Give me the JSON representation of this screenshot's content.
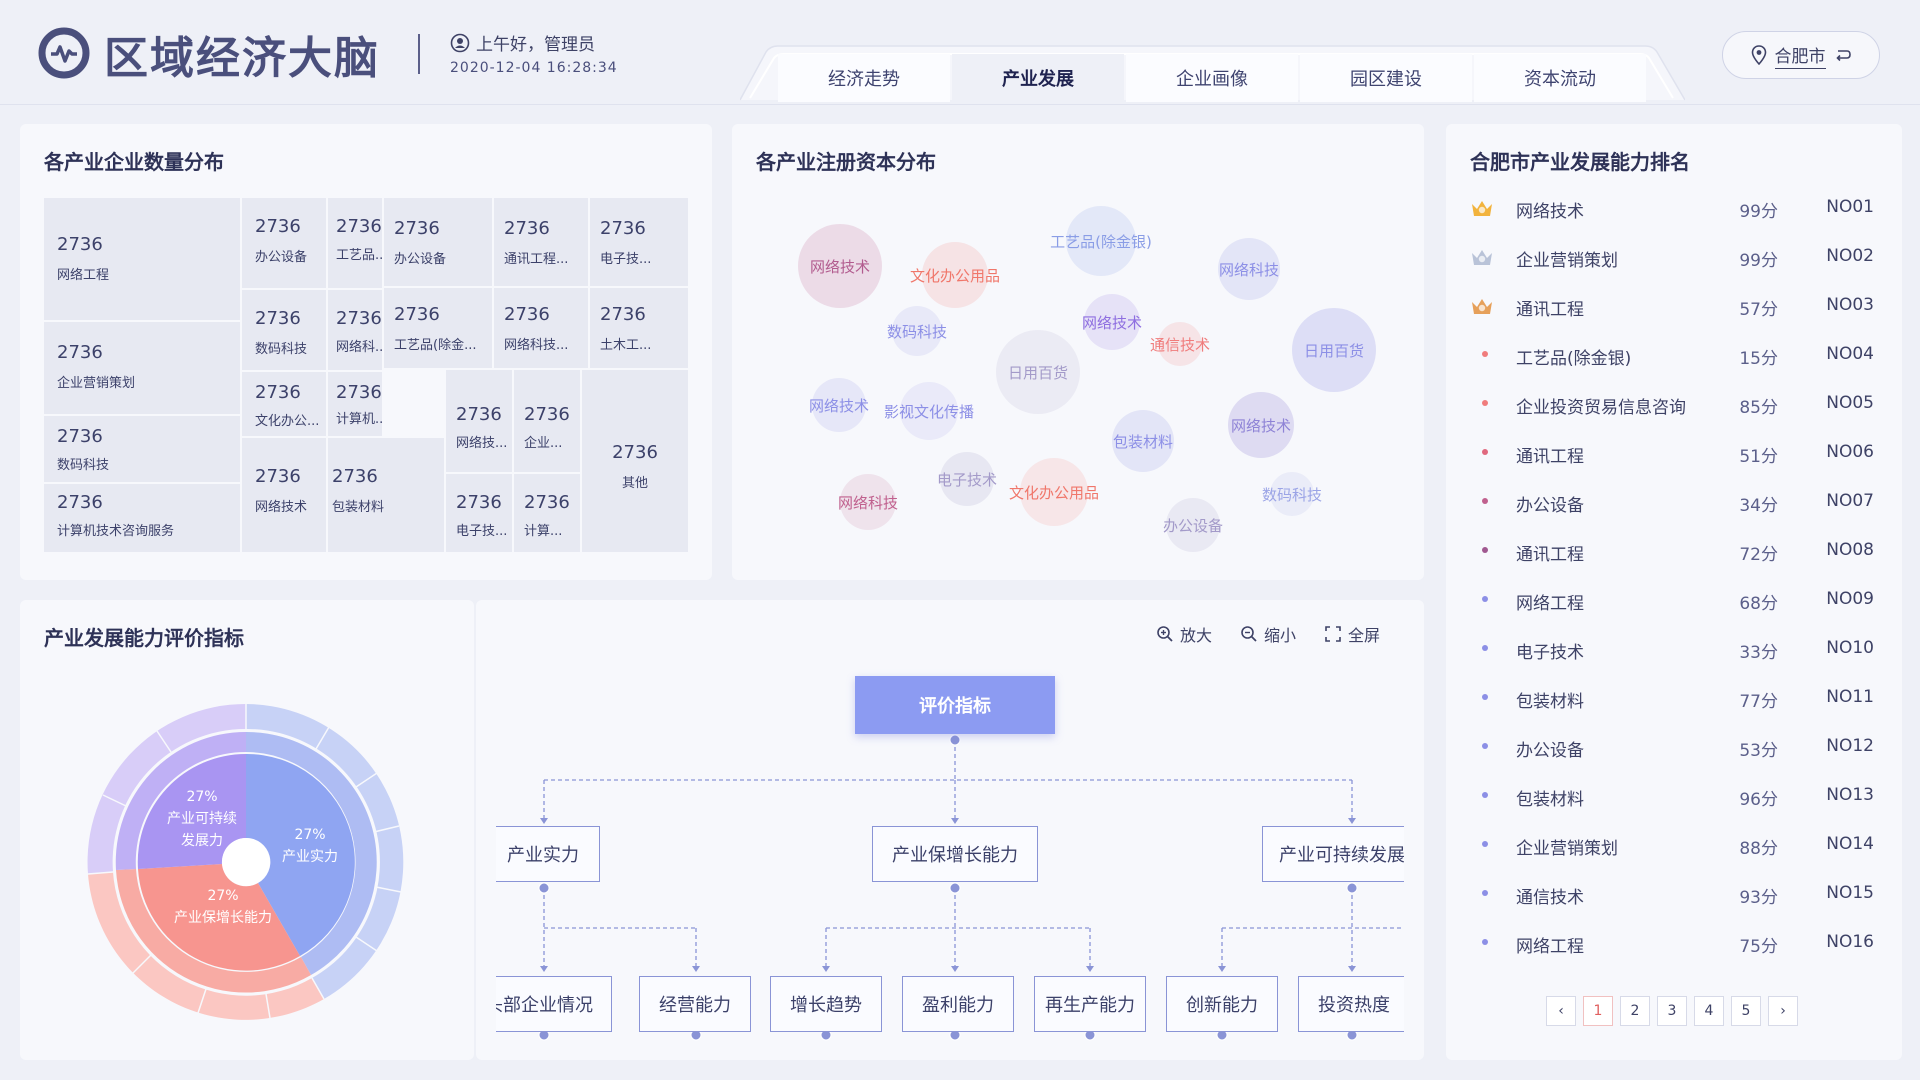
{
  "app": {
    "title": "区域经济大脑",
    "greeting": "上午好，管理员",
    "datetime": "2020-12-04  16:28:34",
    "city": "合肥市",
    "icons": [
      "brain-logo-icon",
      "user-icon",
      "location-pin-icon",
      "swap-icon"
    ]
  },
  "tabs": [
    {
      "label": "经济走势",
      "active": false
    },
    {
      "label": "产业发展",
      "active": true
    },
    {
      "label": "企业画像",
      "active": false
    },
    {
      "label": "园区建设",
      "active": false
    },
    {
      "label": "资本流动",
      "active": false
    }
  ],
  "treemap": {
    "title": "各产业企业数量分布",
    "cells": [
      {
        "value": "2736",
        "label": "网络工程"
      },
      {
        "value": "2736",
        "label": "企业营销策划"
      },
      {
        "value": "2736",
        "label": "数码科技"
      },
      {
        "value": "2736",
        "label": "计算机技术咨询服务"
      },
      {
        "value": "2736",
        "label": "办公设备"
      },
      {
        "value": "2736",
        "label": "工艺品..."
      },
      {
        "value": "2736",
        "label": "数码科技"
      },
      {
        "value": "2736",
        "label": "网络科..."
      },
      {
        "value": "2736",
        "label": "文化办公..."
      },
      {
        "value": "2736",
        "label": "计算机..."
      },
      {
        "value": "2736",
        "label": "网络技术"
      },
      {
        "value": "2736",
        "label": "包装材料"
      },
      {
        "value": "2736",
        "label": "办公设备"
      },
      {
        "value": "2736",
        "label": "通讯工程..."
      },
      {
        "value": "2736",
        "label": "电子技..."
      },
      {
        "value": "2736",
        "label": "工艺品(除金..."
      },
      {
        "value": "2736",
        "label": "网络科技..."
      },
      {
        "value": "2736",
        "label": "土木工..."
      },
      {
        "value": "2736",
        "label": "网络技..."
      },
      {
        "value": "2736",
        "label": "企业..."
      },
      {
        "value": "2736",
        "label": "电子技..."
      },
      {
        "value": "2736",
        "label": "计算..."
      },
      {
        "value": "2736",
        "label": "其他"
      }
    ]
  },
  "bubbles": {
    "title": "各产业注册资本分布",
    "items": [
      {
        "label": "网络技术",
        "color": "#b25c8f"
      },
      {
        "label": "文化办公用品",
        "color": "#f0776b"
      },
      {
        "label": "工艺品(除金银)",
        "color": "#8a9de6"
      },
      {
        "label": "网络科技",
        "color": "#8c8fe6"
      },
      {
        "label": "数码科技",
        "color": "#8c8fe6"
      },
      {
        "label": "网络技术",
        "color": "#8e6ee0"
      },
      {
        "label": "通信技术",
        "color": "#f07c7c"
      },
      {
        "label": "日用百货",
        "color": "#8c8fe6"
      },
      {
        "label": "日用百货",
        "color": "#a39ac9"
      },
      {
        "label": "网络技术",
        "color": "#8c8fe6"
      },
      {
        "label": "影视文化传播",
        "color": "#8c8fe6"
      },
      {
        "label": "包装材料",
        "color": "#8c8fe6"
      },
      {
        "label": "网络技术",
        "color": "#8e83d6"
      },
      {
        "label": "电子技术",
        "color": "#a39ac9"
      },
      {
        "label": "网络科技",
        "color": "#c0608e"
      },
      {
        "label": "文化办公用品",
        "color": "#f0776b"
      },
      {
        "label": "数码科技",
        "color": "#9ba4e6"
      },
      {
        "label": "办公设备",
        "color": "#a39ac9"
      }
    ]
  },
  "ranking": {
    "title": "合肥市产业发展能力排名",
    "rows": [
      {
        "name": "网络技术",
        "score": "99分",
        "no": "NO01",
        "medal": "gold"
      },
      {
        "name": "企业营销策划",
        "score": "99分",
        "no": "NO02",
        "medal": "silver"
      },
      {
        "name": "通讯工程",
        "score": "57分",
        "no": "NO03",
        "medal": "bronze"
      },
      {
        "name": "工艺品(除金银)",
        "score": "15分",
        "no": "NO04",
        "dot": "#f07c7c"
      },
      {
        "name": "企业投资贸易信息咨询",
        "score": "85分",
        "no": "NO05",
        "dot": "#f07c7c"
      },
      {
        "name": "通讯工程",
        "score": "51分",
        "no": "NO06",
        "dot": "#e0687e"
      },
      {
        "name": "办公设备",
        "score": "34分",
        "no": "NO07",
        "dot": "#c0608e"
      },
      {
        "name": "通讯工程",
        "score": "72分",
        "no": "NO08",
        "dot": "#a05890"
      },
      {
        "name": "网络工程",
        "score": "68分",
        "no": "NO09",
        "dot": "#8c8fe6"
      },
      {
        "name": "电子技术",
        "score": "33分",
        "no": "NO10",
        "dot": "#8c8fe6"
      },
      {
        "name": "包装材料",
        "score": "77分",
        "no": "NO11",
        "dot": "#8c8fe6"
      },
      {
        "name": "办公设备",
        "score": "53分",
        "no": "NO12",
        "dot": "#8c8fe6"
      },
      {
        "name": "包装材料",
        "score": "96分",
        "no": "NO13",
        "dot": "#8c8fe6"
      },
      {
        "name": "企业营销策划",
        "score": "88分",
        "no": "NO14",
        "dot": "#8c8fe6"
      },
      {
        "name": "通信技术",
        "score": "93分",
        "no": "NO15",
        "dot": "#8c8fe6"
      },
      {
        "name": "网络工程",
        "score": "75分",
        "no": "NO16",
        "dot": "#8c8fe6"
      }
    ],
    "pager": {
      "prev": "‹",
      "pages": [
        "1",
        "2",
        "3",
        "4",
        "5"
      ],
      "active": "1",
      "next": "›"
    }
  },
  "sunburst": {
    "title": "产业发展能力评价指标",
    "segments": [
      {
        "pct": "27%",
        "name": "产业实力",
        "color": "#8fa5f2"
      },
      {
        "pct": "27%",
        "name": "产业保增长能力",
        "color": "#f7958f"
      },
      {
        "pct": "27%",
        "name": "产业可持续发展力",
        "name_line1": "产业可持续",
        "name_line2": "发展力",
        "color": "#a995f2"
      }
    ]
  },
  "tree": {
    "toolbar": {
      "zoom_in": "放大",
      "zoom_out": "缩小",
      "fullscreen": "全屏"
    },
    "root": "评价指标",
    "level1": [
      "产业实力",
      "产业保增长能力",
      "产业可持续发展"
    ],
    "level2": [
      "头部企业情况",
      "经营能力",
      "增长趋势",
      "盈利能力",
      "再生产能力",
      "创新能力",
      "投资热度"
    ]
  }
}
